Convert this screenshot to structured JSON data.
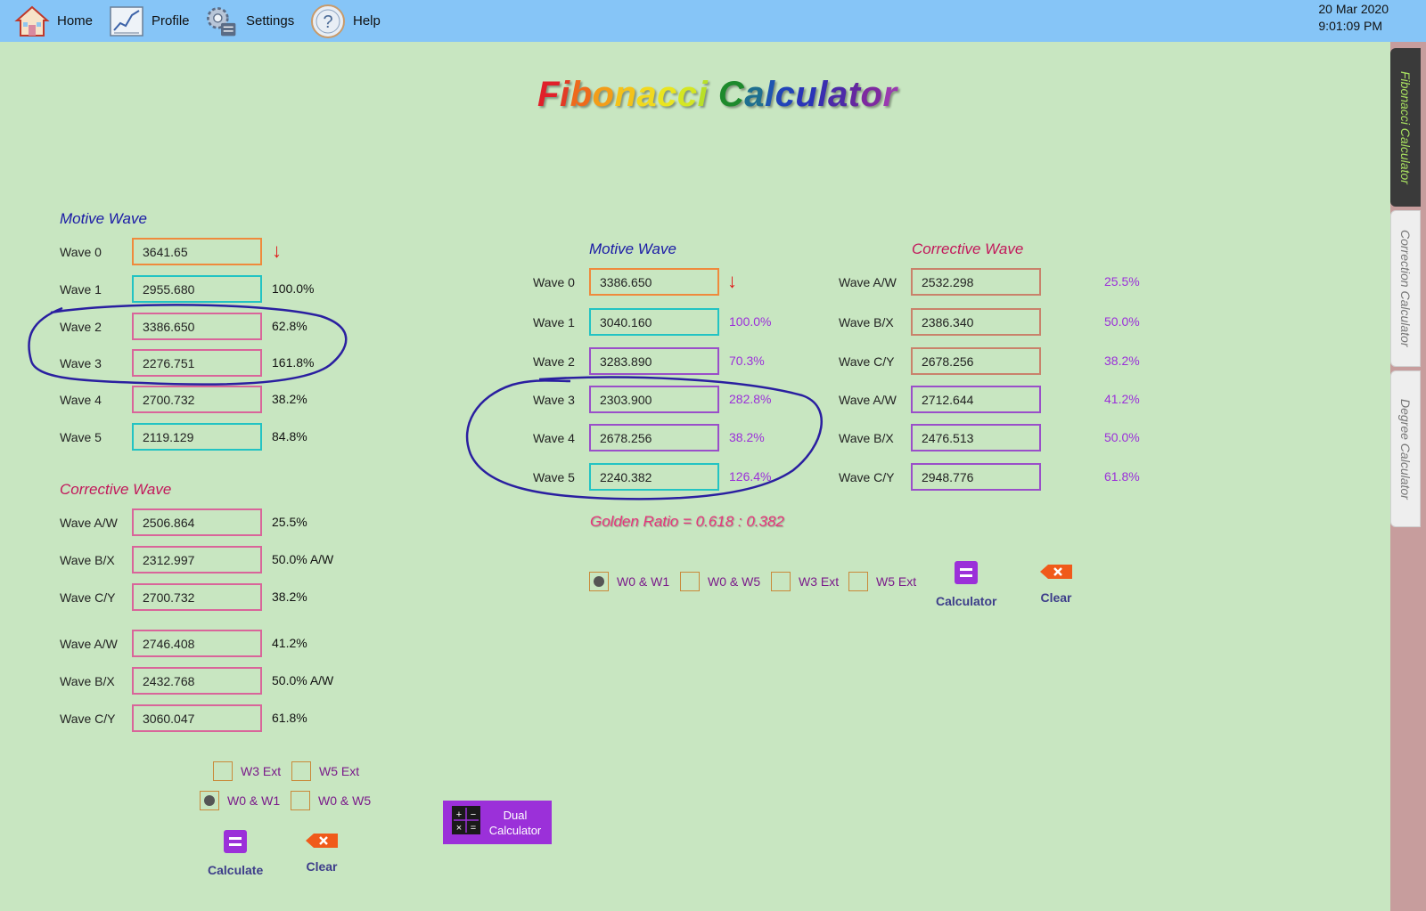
{
  "nav": {
    "home": "Home",
    "profile": "Profile",
    "settings": "Settings",
    "help": "Help",
    "date": "20 Mar 2020",
    "time": "9:01:09 PM"
  },
  "side_tabs": [
    "Fibonacci Calculator",
    "Correction Calculator",
    "Degree Calculator"
  ],
  "title_letters": [
    {
      "c": "F",
      "color": "#e0202a"
    },
    {
      "c": "i",
      "color": "#e23b25"
    },
    {
      "c": "b",
      "color": "#ee6a1c"
    },
    {
      "c": "o",
      "color": "#f29d19"
    },
    {
      "c": "n",
      "color": "#f4c21a"
    },
    {
      "c": "a",
      "color": "#f1d91e"
    },
    {
      "c": "c",
      "color": "#e9e520"
    },
    {
      "c": "c",
      "color": "#d4e623"
    },
    {
      "c": "i",
      "color": "#b8e028"
    },
    {
      "c": " ",
      "color": "#000000"
    },
    {
      "c": "C",
      "color": "#1e8a2c"
    },
    {
      "c": "a",
      "color": "#1e6f8f"
    },
    {
      "c": "l",
      "color": "#1e55b0"
    },
    {
      "c": "c",
      "color": "#2244b8"
    },
    {
      "c": "u",
      "color": "#2a34b8"
    },
    {
      "c": "l",
      "color": "#3a2eb0"
    },
    {
      "c": "a",
      "color": "#4d2aa8"
    },
    {
      "c": "t",
      "color": "#6428a0"
    },
    {
      "c": "o",
      "color": "#7e2aa0"
    },
    {
      "c": "r",
      "color": "#9a3ab0"
    }
  ],
  "left": {
    "motive_title": "Motive Wave",
    "motive": [
      {
        "label": "Wave 0",
        "value": "3641.65",
        "pct": ""
      },
      {
        "label": "Wave 1",
        "value": "2955.680",
        "pct": "100.0%"
      },
      {
        "label": "Wave 2",
        "value": "3386.650",
        "pct": "62.8%"
      },
      {
        "label": "Wave 3",
        "value": "2276.751",
        "pct": "161.8%"
      },
      {
        "label": "Wave 4",
        "value": "2700.732",
        "pct": "38.2%"
      },
      {
        "label": "Wave 5",
        "value": "2119.129",
        "pct": "84.8%"
      }
    ],
    "corrective_title": "Corrective Wave",
    "corrective": [
      {
        "label": "Wave A/W",
        "value": "2506.864",
        "pct": "25.5%"
      },
      {
        "label": "Wave B/X",
        "value": "2312.997",
        "pct": "50.0% A/W"
      },
      {
        "label": "Wave C/Y",
        "value": "2700.732",
        "pct": "38.2%"
      },
      {
        "label": "Wave A/W",
        "value": "2746.408",
        "pct": "41.2%"
      },
      {
        "label": "Wave B/X",
        "value": "2432.768",
        "pct": "50.0% A/W"
      },
      {
        "label": "Wave C/Y",
        "value": "3060.047",
        "pct": "61.8%"
      }
    ],
    "options": [
      "W3 Ext",
      "W5 Ext",
      "W0 & W1",
      "W0 & W5"
    ],
    "calculate": "Calculate",
    "clear": "Clear",
    "dual_calculator": "Dual Calculator"
  },
  "right": {
    "motive_title": "Motive Wave",
    "motive": [
      {
        "label": "Wave 0",
        "value": "3386.650",
        "pct": ""
      },
      {
        "label": "Wave 1",
        "value": "3040.160",
        "pct": "100.0%"
      },
      {
        "label": "Wave 2",
        "value": "3283.890",
        "pct": "70.3%"
      },
      {
        "label": "Wave 3",
        "value": "2303.900",
        "pct": "282.8%"
      },
      {
        "label": "Wave 4",
        "value": "2678.256",
        "pct": "38.2%"
      },
      {
        "label": "Wave 5",
        "value": "2240.382",
        "pct": "126.4%"
      }
    ],
    "corrective_title": "Corrective Wave",
    "corrective": [
      {
        "label": "Wave A/W",
        "value": "2532.298",
        "pct": "25.5%"
      },
      {
        "label": "Wave B/X",
        "value": "2386.340",
        "pct": "50.0%"
      },
      {
        "label": "Wave C/Y",
        "value": "2678.256",
        "pct": "38.2%"
      },
      {
        "label": "Wave A/W",
        "value": "2712.644",
        "pct": "41.2%"
      },
      {
        "label": "Wave B/X",
        "value": "2476.513",
        "pct": "50.0%"
      },
      {
        "label": "Wave C/Y",
        "value": "2948.776",
        "pct": "61.8%"
      }
    ],
    "golden_ratio": "Golden Ratio = 0.618 : 0.382",
    "options": [
      "W0 & W1",
      "W0 & W5",
      "W3 Ext",
      "W5 Ext"
    ],
    "calculator": "Calculator",
    "clear": "Clear"
  },
  "arrow_glyph": "↓"
}
